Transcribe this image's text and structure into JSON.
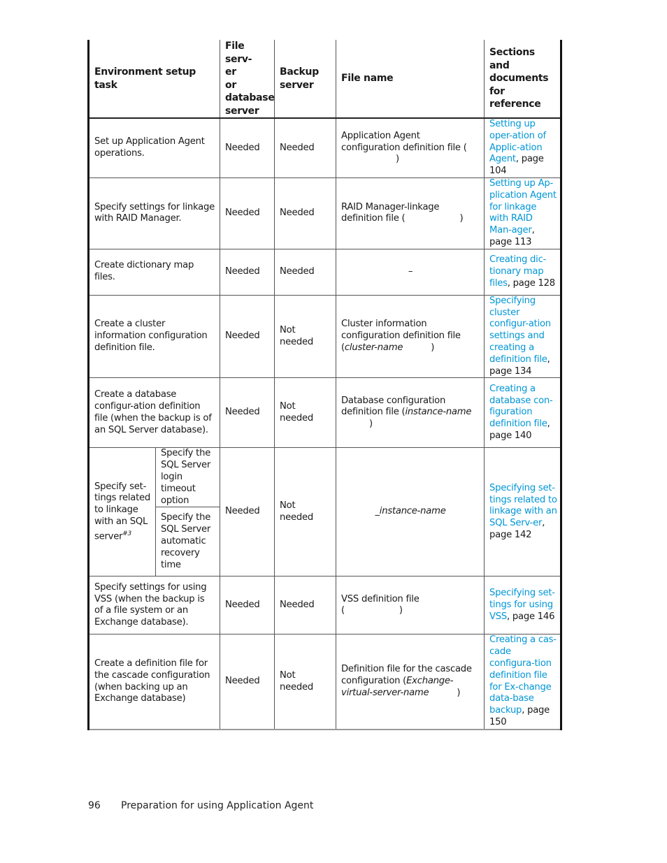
{
  "table": {
    "headers": {
      "task": "Environment setup task",
      "file_server": "File serv-\ner\nor\ndatabase\nserver",
      "backup_server": "Backup\nserver",
      "file_name": "File name",
      "reference": "Sections and\ndocuments for\nreference"
    },
    "rows": [
      {
        "task": "Set up Application Agent operations.",
        "file_server": "Needed",
        "backup_server": "Needed",
        "file_name_prefix": "Application Agent configuration definition file (",
        "file_name_italic": "",
        "file_name_suffix": ")",
        "ref_link": "Setting up oper-ation of Applic-ation Agent",
        "ref_page": ", page 104"
      },
      {
        "task": "Specify settings for linkage with RAID Manager.",
        "file_server": "Needed",
        "backup_server": "Needed",
        "file_name_prefix": "RAID Manager-linkage definition file (",
        "file_name_italic": "",
        "file_name_suffix": ")",
        "ref_link": "Setting up Ap-plication Agent for linkage with RAID Man-ager",
        "ref_page": ", page 113"
      },
      {
        "task": "Create dictionary map files.",
        "file_server": "Needed",
        "backup_server": "Needed",
        "file_name_prefix": "–",
        "file_name_italic": "",
        "file_name_suffix": "",
        "ref_link": "Creating dic-tionary map files",
        "ref_page": ", page 128"
      },
      {
        "task": "Create a cluster information configuration definition file.",
        "file_server": "Needed",
        "backup_server": "Not needed",
        "file_name_prefix": "Cluster information configuration definition file (",
        "file_name_italic": "cluster-name",
        "file_name_suffix": ")",
        "ref_link": "Specifying cluster configur-ation settings and creating a definition file",
        "ref_page": ", page 134"
      },
      {
        "task": "Create a database configur-ation definition file (when the backup is of an SQL Server database).",
        "file_server": "Needed",
        "backup_server": "Not needed",
        "file_name_prefix": "Database configuration definition file (",
        "file_name_italic": "instance-name",
        "file_name_suffix": ")",
        "ref_link": "Creating a database con-figuration definition file",
        "ref_page": ", page 140"
      },
      {
        "task": "Specify set-tings related to linkage with an SQL server",
        "task_sup": "#3",
        "subtasks": [
          "Specify the SQL Server login timeout option",
          "Specify the SQL Server automatic recovery time"
        ],
        "file_server": "Needed",
        "backup_server": "Not needed",
        "file_name_prefix": "_",
        "file_name_italic": "instance-name",
        "file_name_suffix": "",
        "ref_link": "Specifying set-tings related to linkage with an SQL Serv-er",
        "ref_page": ", page 142"
      },
      {
        "task": "Specify settings for using VSS (when the backup is of a file system or an Exchange database).",
        "file_server": "Needed",
        "backup_server": "Needed",
        "file_name_prefix": "VSS definition file",
        "file_name_italic": "",
        "file_name_suffix": ")",
        "ref_link": "Specifying set-tings for using VSS",
        "ref_page": ", page 146"
      },
      {
        "task": "Create a definition file for the cascade configuration (when backing up an Exchange database)",
        "file_server": "Needed",
        "backup_server": "Not needed",
        "file_name_prefix": "Definition file for the cascade configuration (",
        "file_name_italic": "Exchange-virtual-server-name",
        "file_name_suffix": ")",
        "ref_link": "Creating a cas-cade configura-tion definition file for Ex-change data-base backup",
        "ref_page": ", page 150"
      }
    ]
  },
  "footer": {
    "page_number": "96",
    "section_title": "Preparation for using Application Agent"
  },
  "colors": {
    "link": "#0096d6",
    "text": "#1a1a1a"
  }
}
